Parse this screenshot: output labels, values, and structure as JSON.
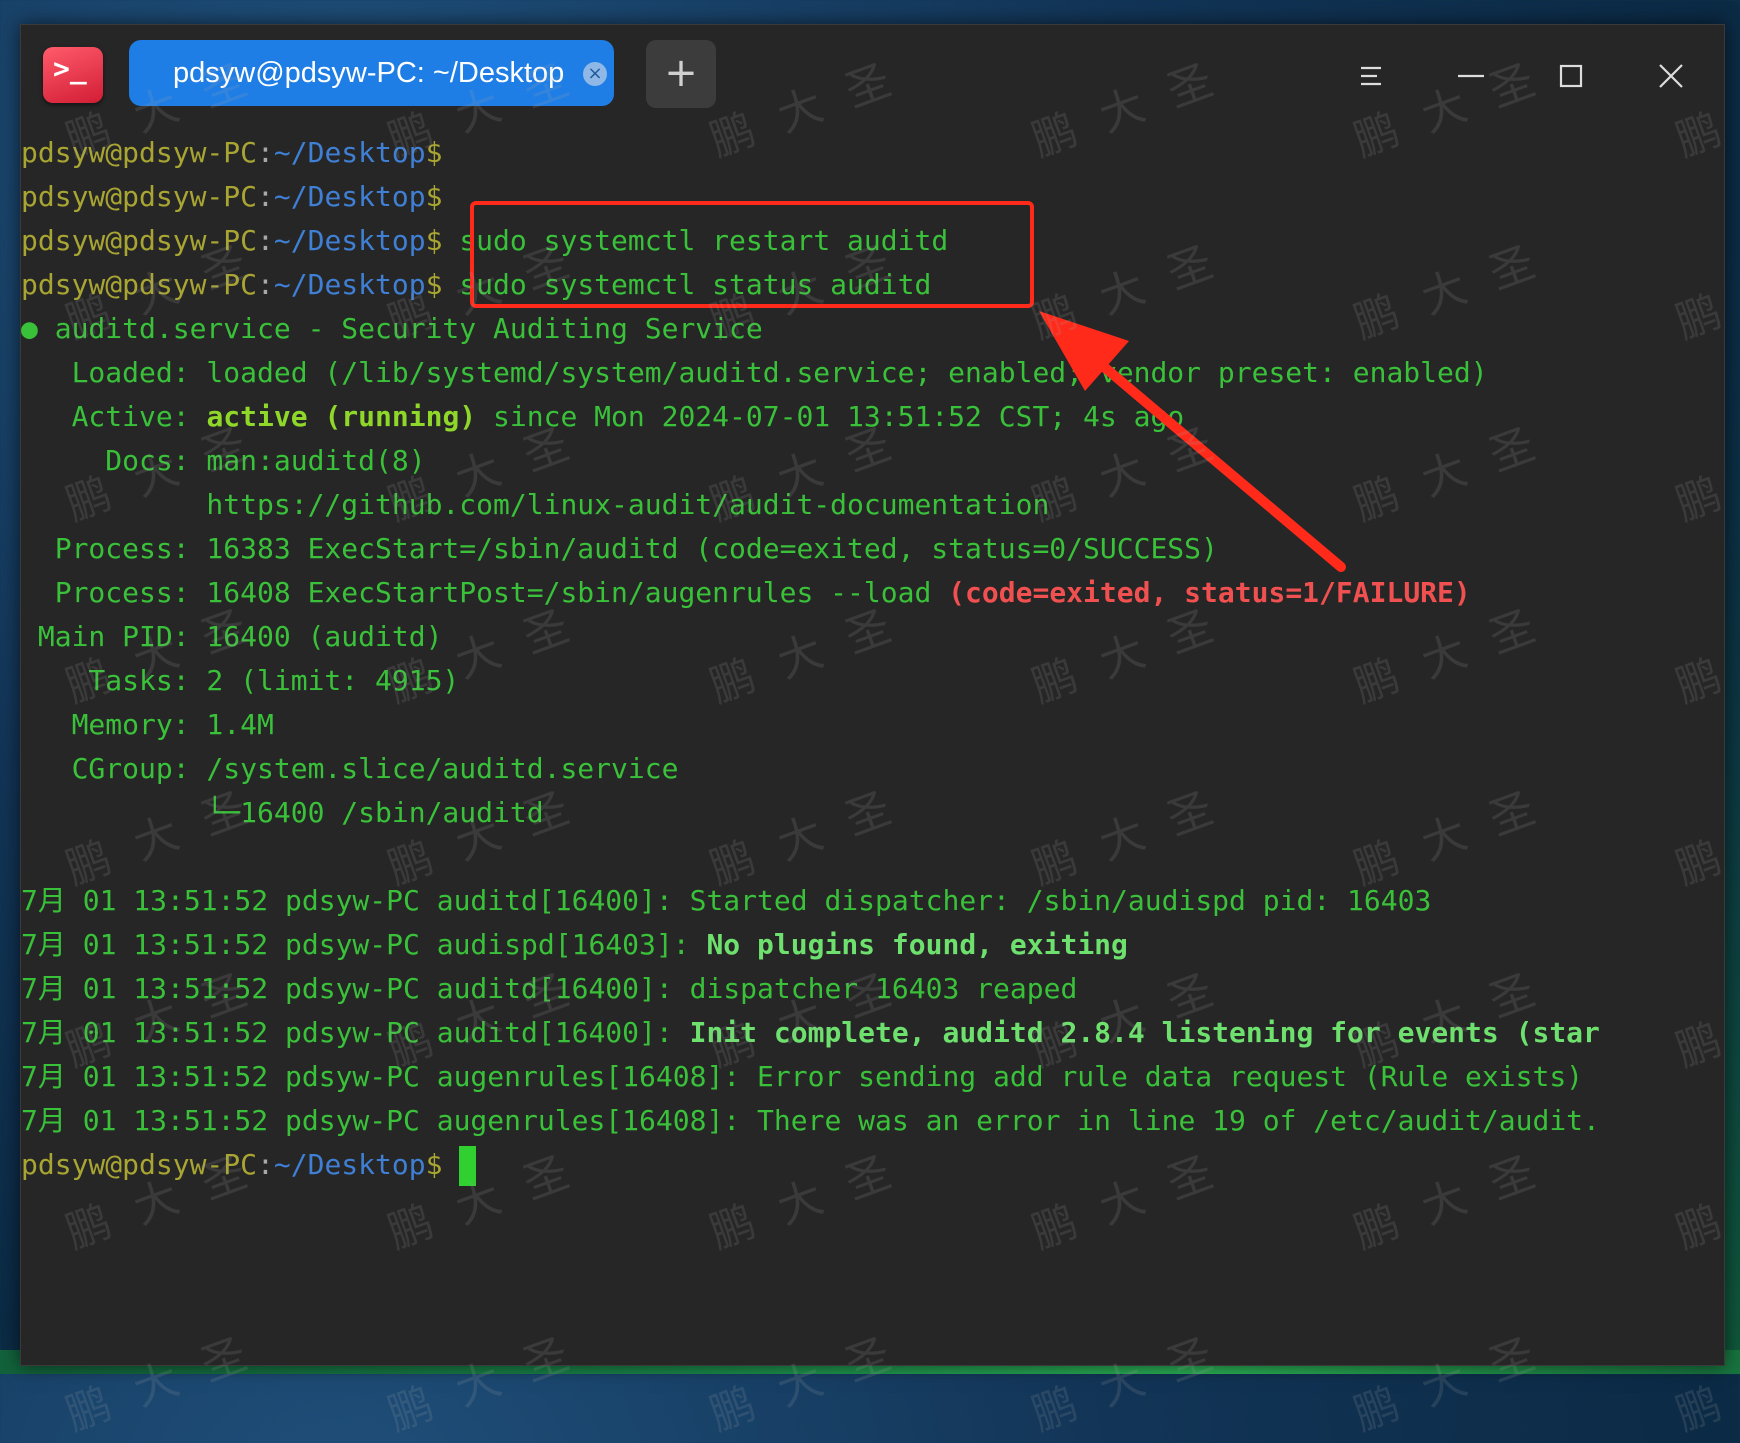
{
  "tab": {
    "title": "pdsyw@pdsyw-PC: ~/Desktop",
    "close_symbol": "×"
  },
  "new_tab_symbol": "+",
  "app_icon_glyph": ">_",
  "prompt": {
    "user": "pdsyw@pdsyw-PC",
    "colon": ":",
    "path": "~/Desktop",
    "dollar": "$"
  },
  "commands": {
    "restart": "sudo systemctl restart auditd",
    "status": "sudo systemctl status auditd"
  },
  "status": {
    "header": "● auditd.service - Security Auditing Service",
    "loaded": "   Loaded: loaded (/lib/systemd/system/auditd.service; enabled; vendor preset: enabled)",
    "active_label": "   Active: ",
    "active_state": "active (running)",
    "active_rest": " since Mon 2024-07-01 13:51:52 CST; 4s ago",
    "docs1": "     Docs: man:auditd(8)",
    "docs2": "           https://github.com/linux-audit/audit-documentation",
    "process1": "  Process: 16383 ExecStart=/sbin/auditd (code=exited, status=0/SUCCESS)",
    "process2_a": "  Process: 16408 ExecStartPost=/sbin/augenrules --load ",
    "process2_fail": "(code=exited, status=1/FAILURE)",
    "main_pid": " Main PID: 16400 (auditd)",
    "tasks": "    Tasks: 2 (limit: 4915)",
    "memory": "   Memory: 1.4M",
    "cgroup": "   CGroup: /system.slice/auditd.service",
    "cgroup_child": "           └─16400 /sbin/auditd"
  },
  "logs": [
    {
      "prefix": "7月 01 13:51:52 pdsyw-PC auditd[16400]: ",
      "msg": "Started dispatcher: /sbin/audispd pid: 16403",
      "bold": false
    },
    {
      "prefix": "7月 01 13:51:52 pdsyw-PC audispd[16403]: ",
      "msg": "No plugins found, exiting",
      "bold": true
    },
    {
      "prefix": "7月 01 13:51:52 pdsyw-PC auditd[16400]: ",
      "msg": "dispatcher 16403 reaped",
      "bold": false
    },
    {
      "prefix": "7月 01 13:51:52 pdsyw-PC auditd[16400]: ",
      "msg": "Init complete, auditd 2.8.4 listening for events (star",
      "bold": true
    },
    {
      "prefix": "7月 01 13:51:52 pdsyw-PC augenrules[16408]: ",
      "msg": "Error sending add rule data request (Rule exists)",
      "bold": false
    },
    {
      "prefix": "7月 01 13:51:52 pdsyw-PC augenrules[16408]: ",
      "msg": "There was an error in line 19 of /etc/audit/audit.",
      "bold": false
    }
  ],
  "watermark_text": "鹏大圣",
  "colors": {
    "annotation": "#ff2a1a",
    "prompt_user": "#a8a533",
    "prompt_path": "#3f7fd4",
    "output_green": "#3ac13a",
    "failure_red": "#f05050",
    "tab_blue": "#1e7ee6"
  },
  "icons": [
    "terminal-app-icon",
    "tab-close-icon",
    "plus-icon",
    "menu-icon",
    "minimize-icon",
    "maximize-icon",
    "close-icon",
    "annotation-arrow"
  ]
}
